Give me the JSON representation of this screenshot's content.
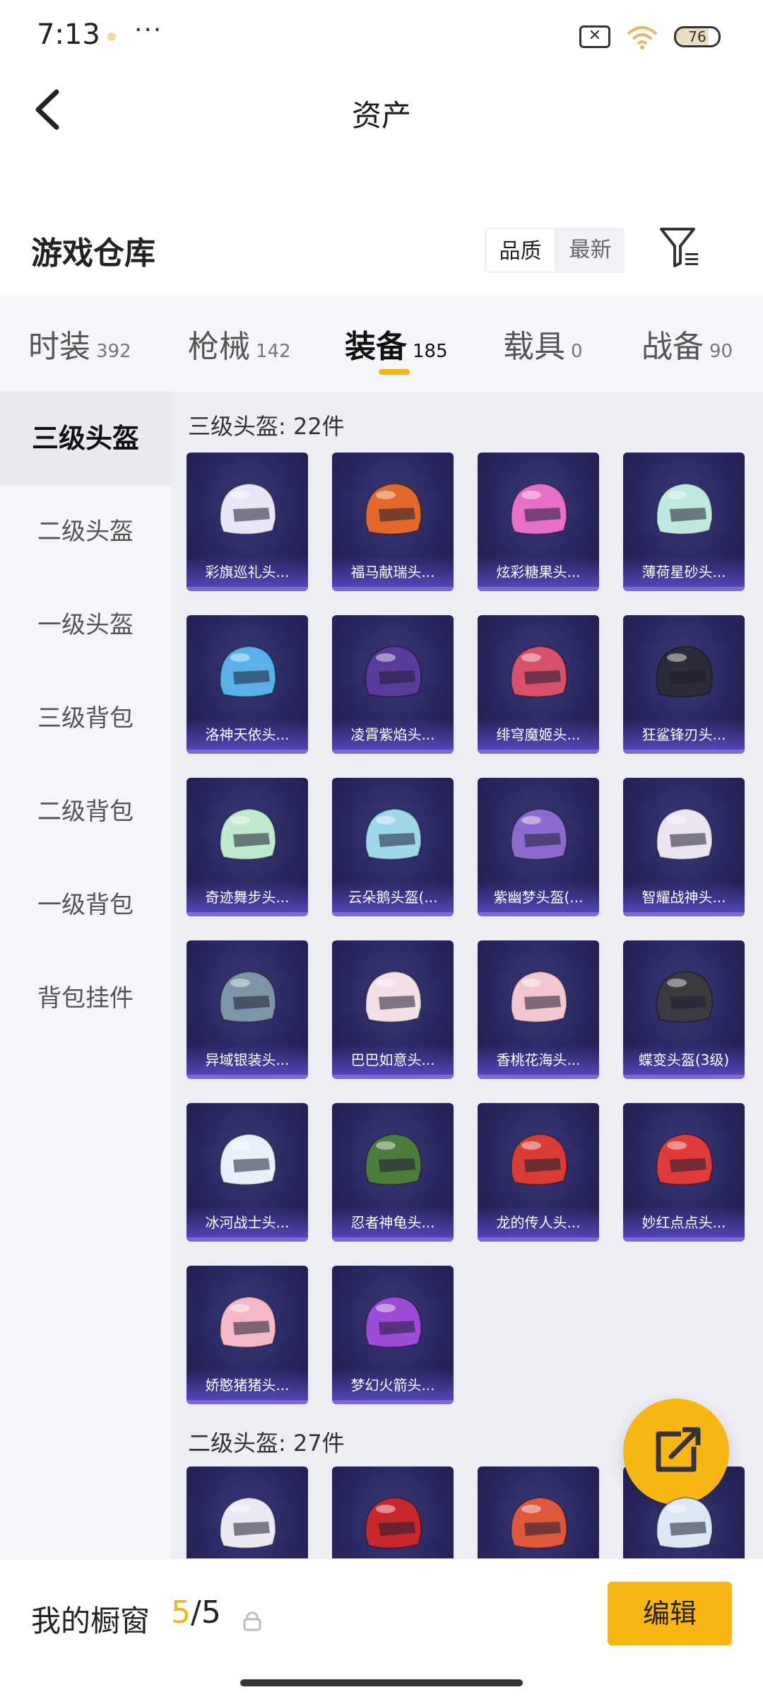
{
  "status_bar": {
    "time": "7:13",
    "more": "···",
    "battery": "76"
  },
  "header": {
    "title": "资产"
  },
  "warehouse": {
    "title": "游戏仓库",
    "sort_options": [
      "品质",
      "最新"
    ],
    "sort_selected": "品质"
  },
  "tabs": [
    {
      "label": "时装",
      "count": "392"
    },
    {
      "label": "枪械",
      "count": "142"
    },
    {
      "label": "装备",
      "count": "185",
      "active": true
    },
    {
      "label": "载具",
      "count": "0"
    },
    {
      "label": "战备",
      "count": "90"
    }
  ],
  "sidebar": {
    "items": [
      {
        "label": "三级头盔",
        "active": true
      },
      {
        "label": "二级头盔"
      },
      {
        "label": "一级头盔"
      },
      {
        "label": "三级背包"
      },
      {
        "label": "二级背包"
      },
      {
        "label": "一级背包"
      },
      {
        "label": "背包挂件"
      }
    ]
  },
  "sections": [
    {
      "title": "三级头盔: 22件",
      "items": [
        {
          "name": "彩旗巡礼头...",
          "color": "#e9e6f5"
        },
        {
          "name": "福马献瑞头...",
          "color": "#e2682c"
        },
        {
          "name": "炫彩糖果头...",
          "color": "#e86fc8"
        },
        {
          "name": "薄荷星砂头...",
          "color": "#bfe8de"
        },
        {
          "name": "洛神天依头...",
          "color": "#5ab0e8"
        },
        {
          "name": "凌霄紫焰头...",
          "color": "#5a3c9c"
        },
        {
          "name": "绯穹魔姬头...",
          "color": "#d8506a"
        },
        {
          "name": "狂鲨锋刃头...",
          "color": "#2c2c38"
        },
        {
          "name": "奇迹舞步头...",
          "color": "#bfead0"
        },
        {
          "name": "云朵鹅头盔(...",
          "color": "#9fd8e8"
        },
        {
          "name": "紫幽梦头盔(...",
          "color": "#8c6ad0"
        },
        {
          "name": "智耀战神头...",
          "color": "#ece4f0"
        },
        {
          "name": "异域银装头...",
          "color": "#7c96a8"
        },
        {
          "name": "巴巴如意头...",
          "color": "#f2e0e4"
        },
        {
          "name": "香桃花海头...",
          "color": "#f4c6d2"
        },
        {
          "name": "蝶变头盔(3级)",
          "color": "#3a3a40"
        },
        {
          "name": "冰河战士头...",
          "color": "#e8f0f8"
        },
        {
          "name": "忍者神龟头...",
          "color": "#4c7c3c"
        },
        {
          "name": "龙的传人头...",
          "color": "#d83c34"
        },
        {
          "name": "妙红点点头...",
          "color": "#e03a3a"
        },
        {
          "name": "娇憨猪猪头...",
          "color": "#f4b8c8"
        },
        {
          "name": "梦幻火箭头...",
          "color": "#9c4cd8"
        }
      ]
    },
    {
      "title": "二级头盔: 27件",
      "items": [
        {
          "name": "",
          "color": "#ece8f4"
        },
        {
          "name": "",
          "color": "#c8282c"
        },
        {
          "name": "",
          "color": "#e0583c"
        },
        {
          "name": "",
          "color": "#dce8f4"
        }
      ]
    }
  ],
  "bottom": {
    "showcase_label": "我的橱窗",
    "current": "5",
    "separator": "/",
    "max": "5",
    "edit_label": "编辑"
  },
  "colors": {
    "accent": "#f7b614",
    "card_bg": "#292760",
    "card_border": "#7c68d8"
  }
}
